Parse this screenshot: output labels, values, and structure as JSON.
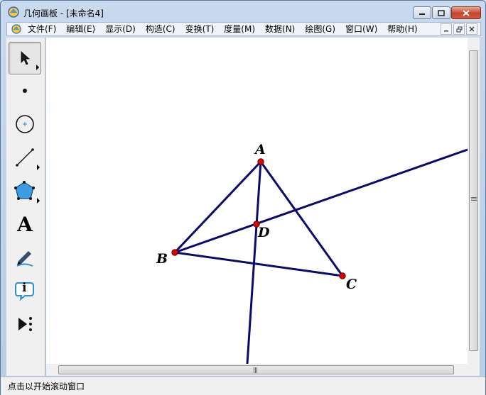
{
  "window": {
    "title": "几何画板 - [未命名4]"
  },
  "menu": {
    "items": [
      "文件(F)",
      "编辑(E)",
      "显示(D)",
      "构造(C)",
      "变换(T)",
      "度量(M)",
      "数据(N)",
      "绘图(G)",
      "窗口(W)",
      "帮助(H)"
    ]
  },
  "tools": [
    {
      "name": "arrow-select-tool",
      "icon": "cursor-arrow-icon",
      "selected": true
    },
    {
      "name": "point-tool",
      "icon": "point-icon"
    },
    {
      "name": "compass-tool",
      "icon": "circle-icon"
    },
    {
      "name": "straightedge-tool",
      "icon": "segment-icon"
    },
    {
      "name": "polygon-tool",
      "icon": "pentagon-icon"
    },
    {
      "name": "text-tool",
      "icon": "text-a-icon",
      "glyph": "A"
    },
    {
      "name": "marker-tool",
      "icon": "marker-pen-icon"
    },
    {
      "name": "information-tool",
      "icon": "info-icon",
      "glyph": "i"
    },
    {
      "name": "custom-tool",
      "icon": "custom-tool-icon"
    }
  ],
  "geometry": {
    "points": [
      {
        "label": "A"
      },
      {
        "label": "B"
      },
      {
        "label": "C"
      },
      {
        "label": "D"
      }
    ],
    "line_color": "#0a0a6e",
    "point_color": "#e00000"
  },
  "status": {
    "text": "点击以开始滚动窗口"
  }
}
